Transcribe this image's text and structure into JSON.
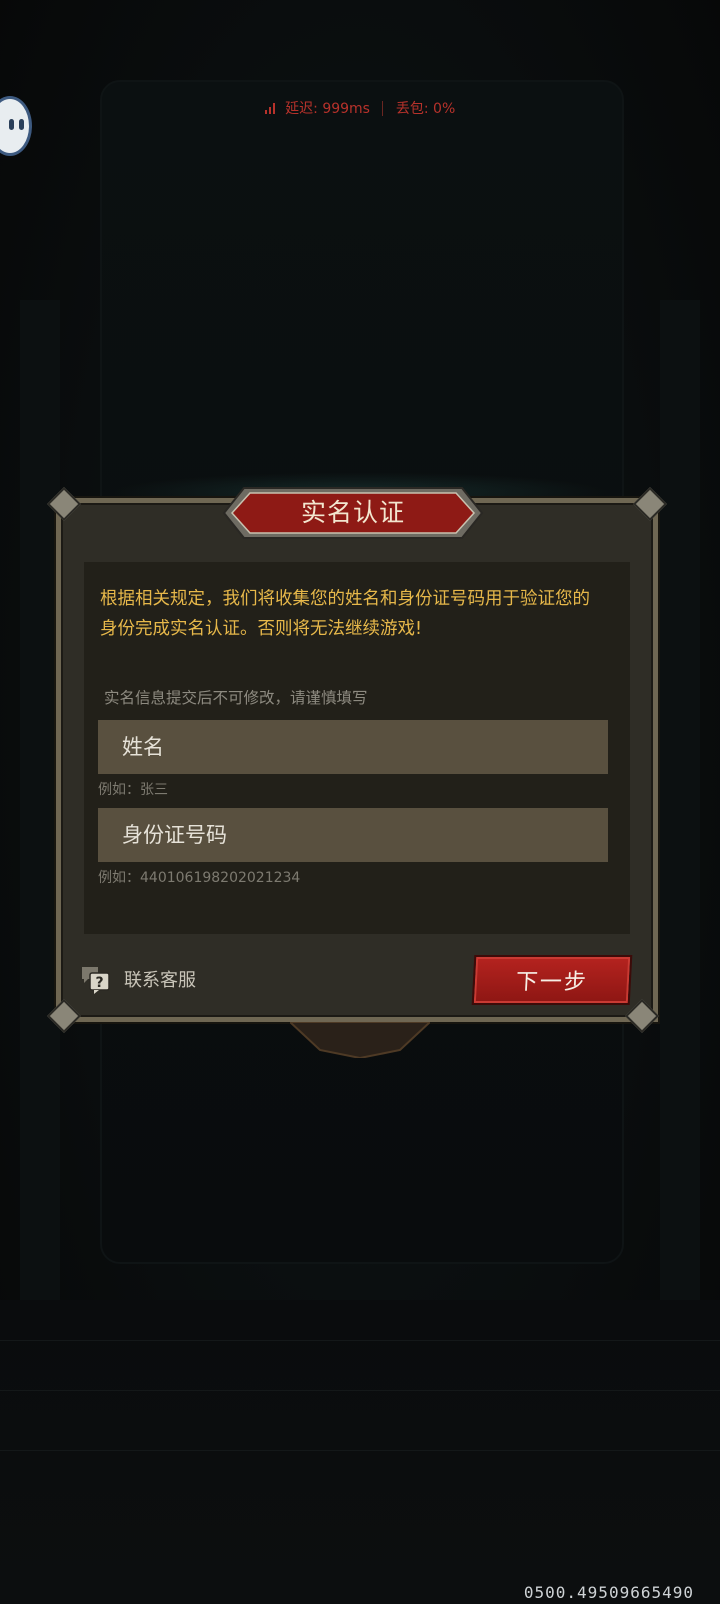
{
  "network": {
    "latency": "延迟: 999ms",
    "packet_loss": "丢包: 0%"
  },
  "dialog": {
    "title": "实名认证",
    "notice": "根据相关规定，我们将收集您的姓名和身份证号码用于验证您的身份完成实名认证。否则将无法继续游戏!",
    "hint": "实名信息提交后不可修改，请谨慎填写",
    "name_field": {
      "placeholder": "姓名",
      "value": "",
      "example": "例如：张三"
    },
    "id_field": {
      "placeholder": "身份证号码",
      "value": "",
      "example": "例如：440106198202021234"
    },
    "support_label": "联系客服",
    "next_label": "下一步"
  },
  "footer": {
    "id_text": "0500.49509665490"
  },
  "colors": {
    "notice": "#e7b84a",
    "accent_red": "#a11d1a",
    "latency_red": "#b7322b"
  },
  "icons": [
    "signal-icon",
    "customer-service-icon",
    "floating-assistant-icon"
  ]
}
